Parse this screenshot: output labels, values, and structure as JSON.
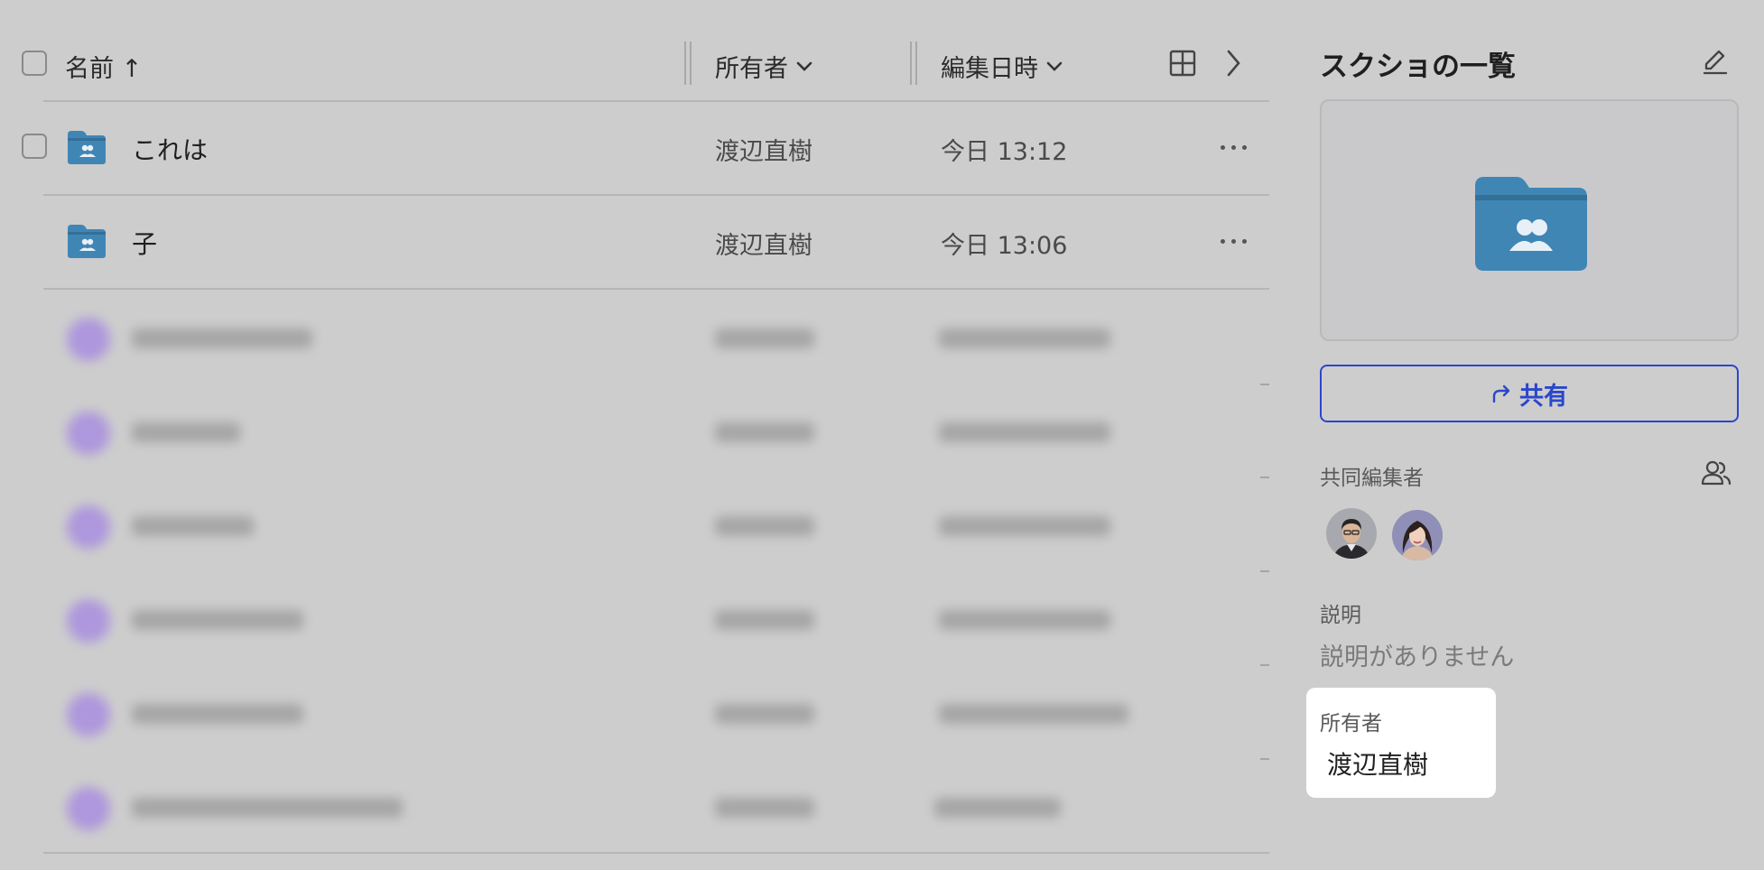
{
  "table": {
    "columns": {
      "name": "名前 ↑",
      "owner": "所有者",
      "modified": "編集日時"
    },
    "rows": [
      {
        "name": "これは",
        "owner": "渡辺直樹",
        "modified": "今日 13:12"
      },
      {
        "name": "子",
        "owner": "渡辺直樹",
        "modified": "今日 13:06"
      }
    ],
    "blurred_rows": 6
  },
  "panel": {
    "title": "スクショの一覧",
    "share_label": "共有",
    "collaborators_label": "共同編集者",
    "description_label": "説明",
    "description_value": "説明がありません",
    "owner_label": "所有者",
    "owner_value": "渡辺直樹"
  },
  "icons": {
    "folder": "shared-folder-icon",
    "edit": "pencil-icon",
    "share": "share-arrow-icon",
    "collaborators": "people-icon",
    "grid": "grid-view-icon",
    "next": "chevron-right-icon",
    "sort": "chevron-down-icon"
  },
  "colors": {
    "accent": "#2b47c9",
    "folder": "#3f86b5",
    "background": "#cdcdcd"
  }
}
